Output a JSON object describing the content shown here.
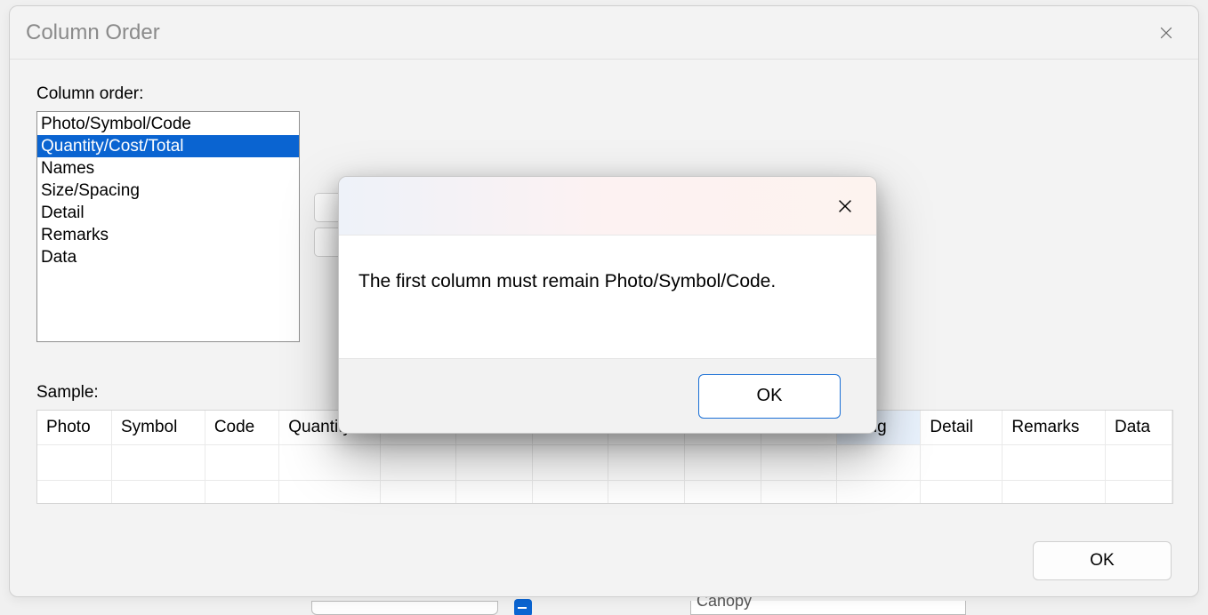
{
  "dialog": {
    "title": "Column Order",
    "order_label": "Column order:",
    "list": {
      "items": [
        "Photo/Symbol/Code",
        "Quantity/Cost/Total",
        "Names",
        "Size/Spacing",
        "Detail",
        "Remarks",
        "Data"
      ],
      "selected_index": 1
    },
    "sample_label": "Sample:",
    "sample_headers": [
      "Photo",
      "Symbol",
      "Code",
      "Quantity",
      "",
      "",
      "",
      "",
      "",
      "",
      "acing",
      "Detail",
      "Remarks",
      "Data"
    ],
    "highlighted_header_index": 10,
    "ok_label": "OK"
  },
  "alert": {
    "message": "The first column must remain Photo/Symbol/Code.",
    "ok_label": "OK"
  },
  "background": {
    "dropdown_partial_text": "Canopy"
  }
}
